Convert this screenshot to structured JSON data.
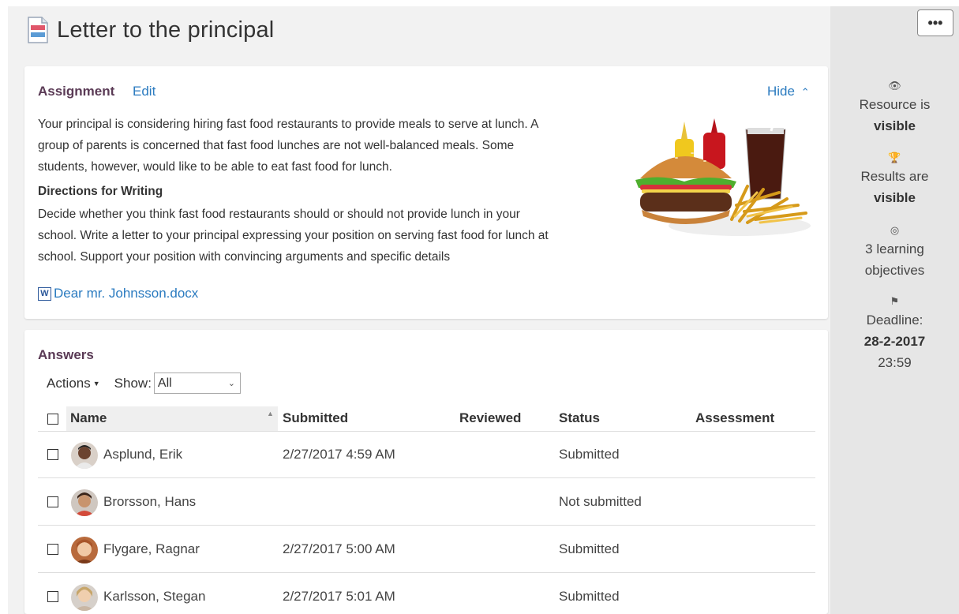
{
  "page": {
    "title": "Letter to the principal",
    "more_label": "•••"
  },
  "assignment": {
    "heading": "Assignment",
    "edit_label": "Edit",
    "hide_label": "Hide",
    "intro_lines": [
      "Your principal is considering hiring fast food restaurants to provide meals to serve at lunch. A",
      "group of parents is concerned that fast food lunches are not well-balanced meals. Some",
      "students, however, would like to be able to eat fast food for lunch."
    ],
    "directions_title": "Directions for Writing",
    "directions_lines": [
      "Decide whether you think fast food restaurants should or should not provide lunch in your",
      "school. Write a letter to your principal expressing your position on serving fast food for lunch at",
      "school. Support your position with convincing arguments and specific details"
    ],
    "attachment_icon": "W",
    "attachment_name": "Dear mr. Johnsson.docx"
  },
  "sidebar": {
    "resource_line1": "Resource is",
    "resource_line2": "visible",
    "results_line1": "Results are",
    "results_line2": "visible",
    "objectives_line1": "3 learning",
    "objectives_line2": "objectives",
    "deadline_label": "Deadline:",
    "deadline_date": "28-2-2017",
    "deadline_time": "23:59"
  },
  "answers": {
    "heading": "Answers",
    "actions_label": "Actions",
    "show_label": "Show:",
    "show_value": "All",
    "columns": {
      "name": "Name",
      "submitted": "Submitted",
      "reviewed": "Reviewed",
      "status": "Status",
      "assessment": "Assessment"
    },
    "rows": [
      {
        "name": "Asplund, Erik",
        "submitted": "2/27/2017 4:59 AM",
        "reviewed": "",
        "status": "Submitted",
        "assessment": ""
      },
      {
        "name": "Brorsson, Hans",
        "submitted": "",
        "reviewed": "",
        "status": "Not submitted",
        "assessment": ""
      },
      {
        "name": "Flygare, Ragnar",
        "submitted": "2/27/2017 5:00 AM",
        "reviewed": "",
        "status": "Submitted",
        "assessment": ""
      },
      {
        "name": "Karlsson, Stegan",
        "submitted": "2/27/2017 5:01 AM",
        "reviewed": "",
        "status": "Submitted",
        "assessment": ""
      }
    ]
  },
  "colors": {
    "link": "#2b7bc0",
    "section_title": "#5a3a55",
    "background": "#f2f2f2",
    "sidebar": "#e6e6e6"
  }
}
